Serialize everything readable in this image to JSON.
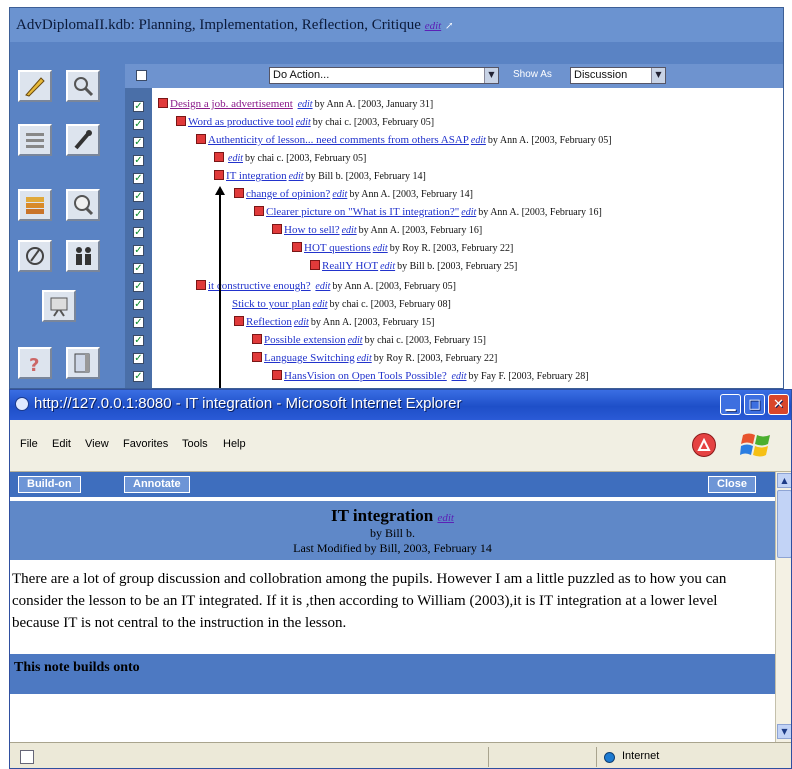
{
  "kdb": {
    "title": "AdvDiplomaII.kdb: Planning, Implementation, Reflection, Critique",
    "edit_label": "edit",
    "do_action": "Do Action...",
    "show_as_label": "Show As",
    "show_as_value": "Discussion",
    "tools": [
      "pencil-icon",
      "magnifier-icon",
      "list-icon",
      "tools-icon",
      "stack-icon",
      "search-icon",
      "compass-icon",
      "people-icon",
      "easel-icon",
      "help-icon",
      "book-icon"
    ],
    "notes": [
      {
        "title": "Design a job. advertisement",
        "meta": "by Ann A. [2003, January 31]"
      },
      {
        "title": "Word as productive tool",
        "meta": "by chai c. [2003, February 05]"
      },
      {
        "title": "Authenticity of lesson... need comments from others ASAP",
        "meta": "by Ann A. [2003, February 05]"
      },
      {
        "title": "",
        "meta": "by chai c. [2003, February 05]"
      },
      {
        "title": "IT integration",
        "meta": "by Bill b. [2003, February 14]"
      },
      {
        "title": "change of opinion?",
        "meta": "by Ann A. [2003, February 14]"
      },
      {
        "title": "Clearer picture on \"What is IT integration?\"",
        "meta": "by Ann A. [2003, February 16]"
      },
      {
        "title": "How to sell?",
        "meta": "by Ann A. [2003, February 16]"
      },
      {
        "title": "HOT questions",
        "meta": "by Roy R. [2003, February 22]"
      },
      {
        "title": "ReallY HOT",
        "meta": "by Bill b. [2003, February 25]"
      },
      {
        "title": "it constructive enough?",
        "meta": "by Ann A. [2003, February 05]"
      },
      {
        "title": "Stick to your plan",
        "meta": "by chai c. [2003, February 08]"
      },
      {
        "title": "Reflection",
        "meta": "by Ann A. [2003, February 15]"
      },
      {
        "title": "Possible extension",
        "meta": "by chai c. [2003, February 15]"
      },
      {
        "title": "Language Switching",
        "meta": "by Roy R. [2003, February 22]"
      },
      {
        "title": "HansVision on Open Tools Possible?",
        "meta": "by Fay F. [2003, February 28]"
      }
    ]
  },
  "ie": {
    "title": "http://127.0.0.1:8080 - IT integration - Microsoft Internet Explorer",
    "menu": [
      "File",
      "Edit",
      "View",
      "Favorites",
      "Tools",
      "Help"
    ],
    "buttons": {
      "build_on": "Build-on",
      "annotate": "Annotate",
      "close": "Close"
    },
    "note": {
      "title": "IT integration",
      "edit": "edit",
      "by": "by Bill b.",
      "modified": "Last Modified by Bill, 2003, February 14",
      "body": "There are a lot of group discussion and collobration among the pupils. However I am a little puzzled as to how you can consider the lesson to be an IT integrated. If it is ,then according to William (2003),it is IT integration at a lower level because IT is not central to the instruction in the lesson.",
      "builds_onto": "This note builds onto"
    },
    "status": {
      "zone": "Internet"
    }
  },
  "colors": {
    "accent": "#5a83c4",
    "ie_title": "#1e4fc8",
    "note_icon": "#e03a3a"
  }
}
